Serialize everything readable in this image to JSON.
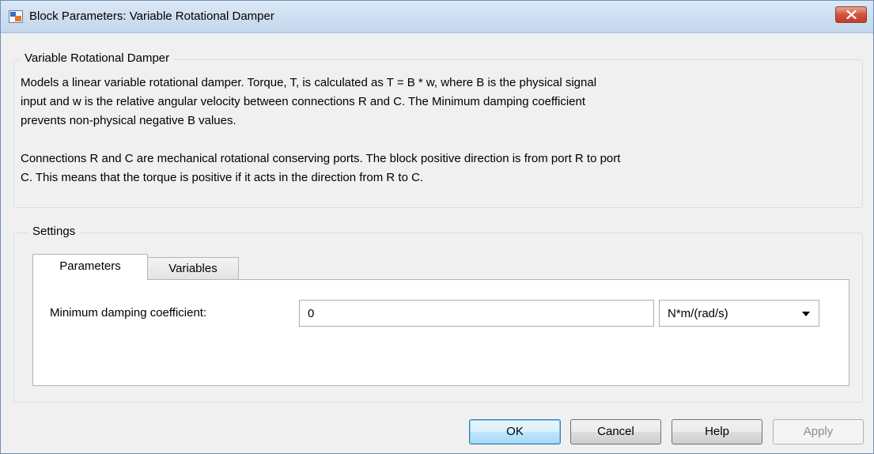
{
  "window": {
    "title": "Block Parameters: Variable Rotational Damper",
    "close_icon": "close-icon",
    "app_icon": "simulink-block-icon"
  },
  "description": {
    "legend": "Variable Rotational Damper",
    "line1": "Models a linear variable rotational damper. Torque, T, is calculated as T = B * w, where B is the physical signal",
    "line2": "input and w is the relative angular velocity between connections R and C. The Minimum damping coefficient",
    "line3": "prevents non-physical negative B values.",
    "line4": "Connections R and C are mechanical rotational conserving ports. The block positive direction is from port R to port",
    "line5": "C. This means that the torque is positive if it acts in the direction from R to C."
  },
  "settings": {
    "legend": "Settings",
    "tabs": [
      {
        "label": "Parameters",
        "active": true
      },
      {
        "label": "Variables",
        "active": false
      }
    ],
    "parameters": {
      "min_damping_label": "Minimum damping coefficient:",
      "min_damping_value": "0",
      "unit_selected": "N*m/(rad/s)"
    }
  },
  "buttons": {
    "ok": "OK",
    "cancel": "Cancel",
    "help": "Help",
    "apply": "Apply"
  },
  "colors": {
    "close_button": "#c74532",
    "window_border": "#6f8fb3",
    "ok_button_border": "#3c7fb1",
    "disabled_text": "#8d8d8d"
  }
}
